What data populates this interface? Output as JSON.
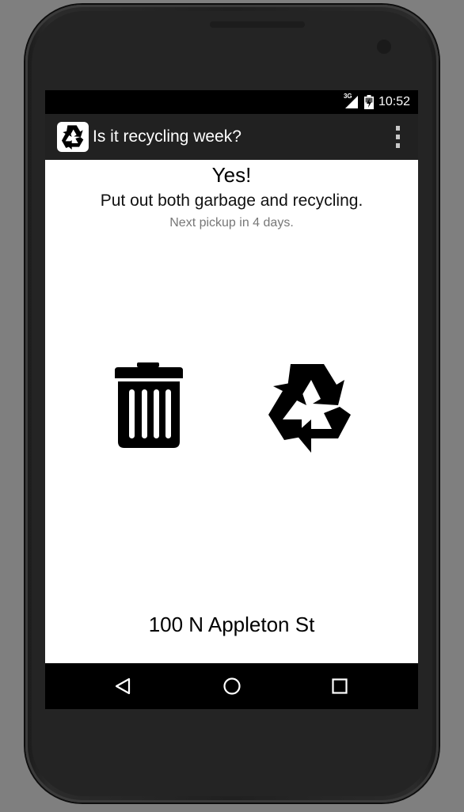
{
  "status_bar": {
    "network_type": "3G",
    "time": "10:52"
  },
  "action_bar": {
    "app_icon": "recycle-icon",
    "title": "Is it recycling week?",
    "overflow_icon": "overflow-menu-icon"
  },
  "main": {
    "answer": "Yes!",
    "instruction": "Put out both garbage and recycling.",
    "next_pickup": "Next pickup in 4 days.",
    "icons": [
      "trash-can-icon",
      "recycle-icon"
    ],
    "address": "100 N Appleton St"
  },
  "nav_bar": {
    "buttons": [
      "back-icon",
      "home-icon",
      "recents-icon"
    ]
  },
  "colors": {
    "action_bar": "#212121",
    "content_bg": "#ffffff",
    "device_bg": "#7f7f7f",
    "secondary_text": "#777777"
  }
}
